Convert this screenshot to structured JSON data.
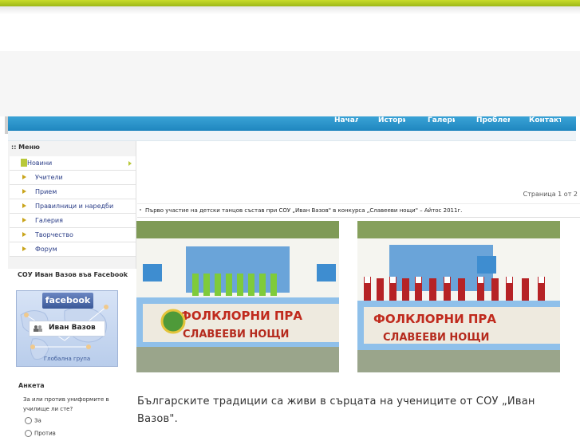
{
  "nav": {
    "items": [
      {
        "label": "Начал о"
      },
      {
        "label": "Истори я"
      },
      {
        "label": "Галери я"
      },
      {
        "label": "Проблем и"
      },
      {
        "label": "Контакт и"
      }
    ]
  },
  "menu": {
    "title": ":: Меню",
    "items": [
      {
        "label": "Новини"
      },
      {
        "label": "Учители"
      },
      {
        "label": "Прием"
      },
      {
        "label": "Правилници и наредби"
      },
      {
        "label": "Галерия"
      },
      {
        "label": "Творчество"
      },
      {
        "label": "Форум"
      }
    ]
  },
  "facebook": {
    "title": "СОУ Иван Вазов във Facebook",
    "logo": "facebook",
    "name": "Иван Вазов",
    "link": "Глобална група",
    "icons": {
      "user": "users-icon",
      "logo": "facebook-logo"
    }
  },
  "poll": {
    "title": "Анкета",
    "question": "За или против униформите в училище ли сте?",
    "options": [
      "За",
      "Против"
    ]
  },
  "article": {
    "pager": "Страница 1 от 2",
    "title": "Първо участие на детски танцов състав при СОУ „Иван Вазов\" в конкурса „Славееви нощи\" – Айтос 2011г.",
    "photo_banner_text": [
      "ФОЛКЛОРНИ ПРА",
      "СЛАВЕЕВИ НОЩИ"
    ],
    "photo_banner_text_2": [
      "ФОЛКЛОРНИ ПРА",
      "СЛАВЕЕВИ НОЩИ"
    ],
    "body": "Българските традиции са живи в сърцата на учениците от СОУ „Иван Вазов\"."
  },
  "colors": {
    "top_bar": "#b3cc22",
    "nav": "#2b93c9",
    "menu_link": "#2a3d87",
    "accent": "#c9a41b"
  }
}
